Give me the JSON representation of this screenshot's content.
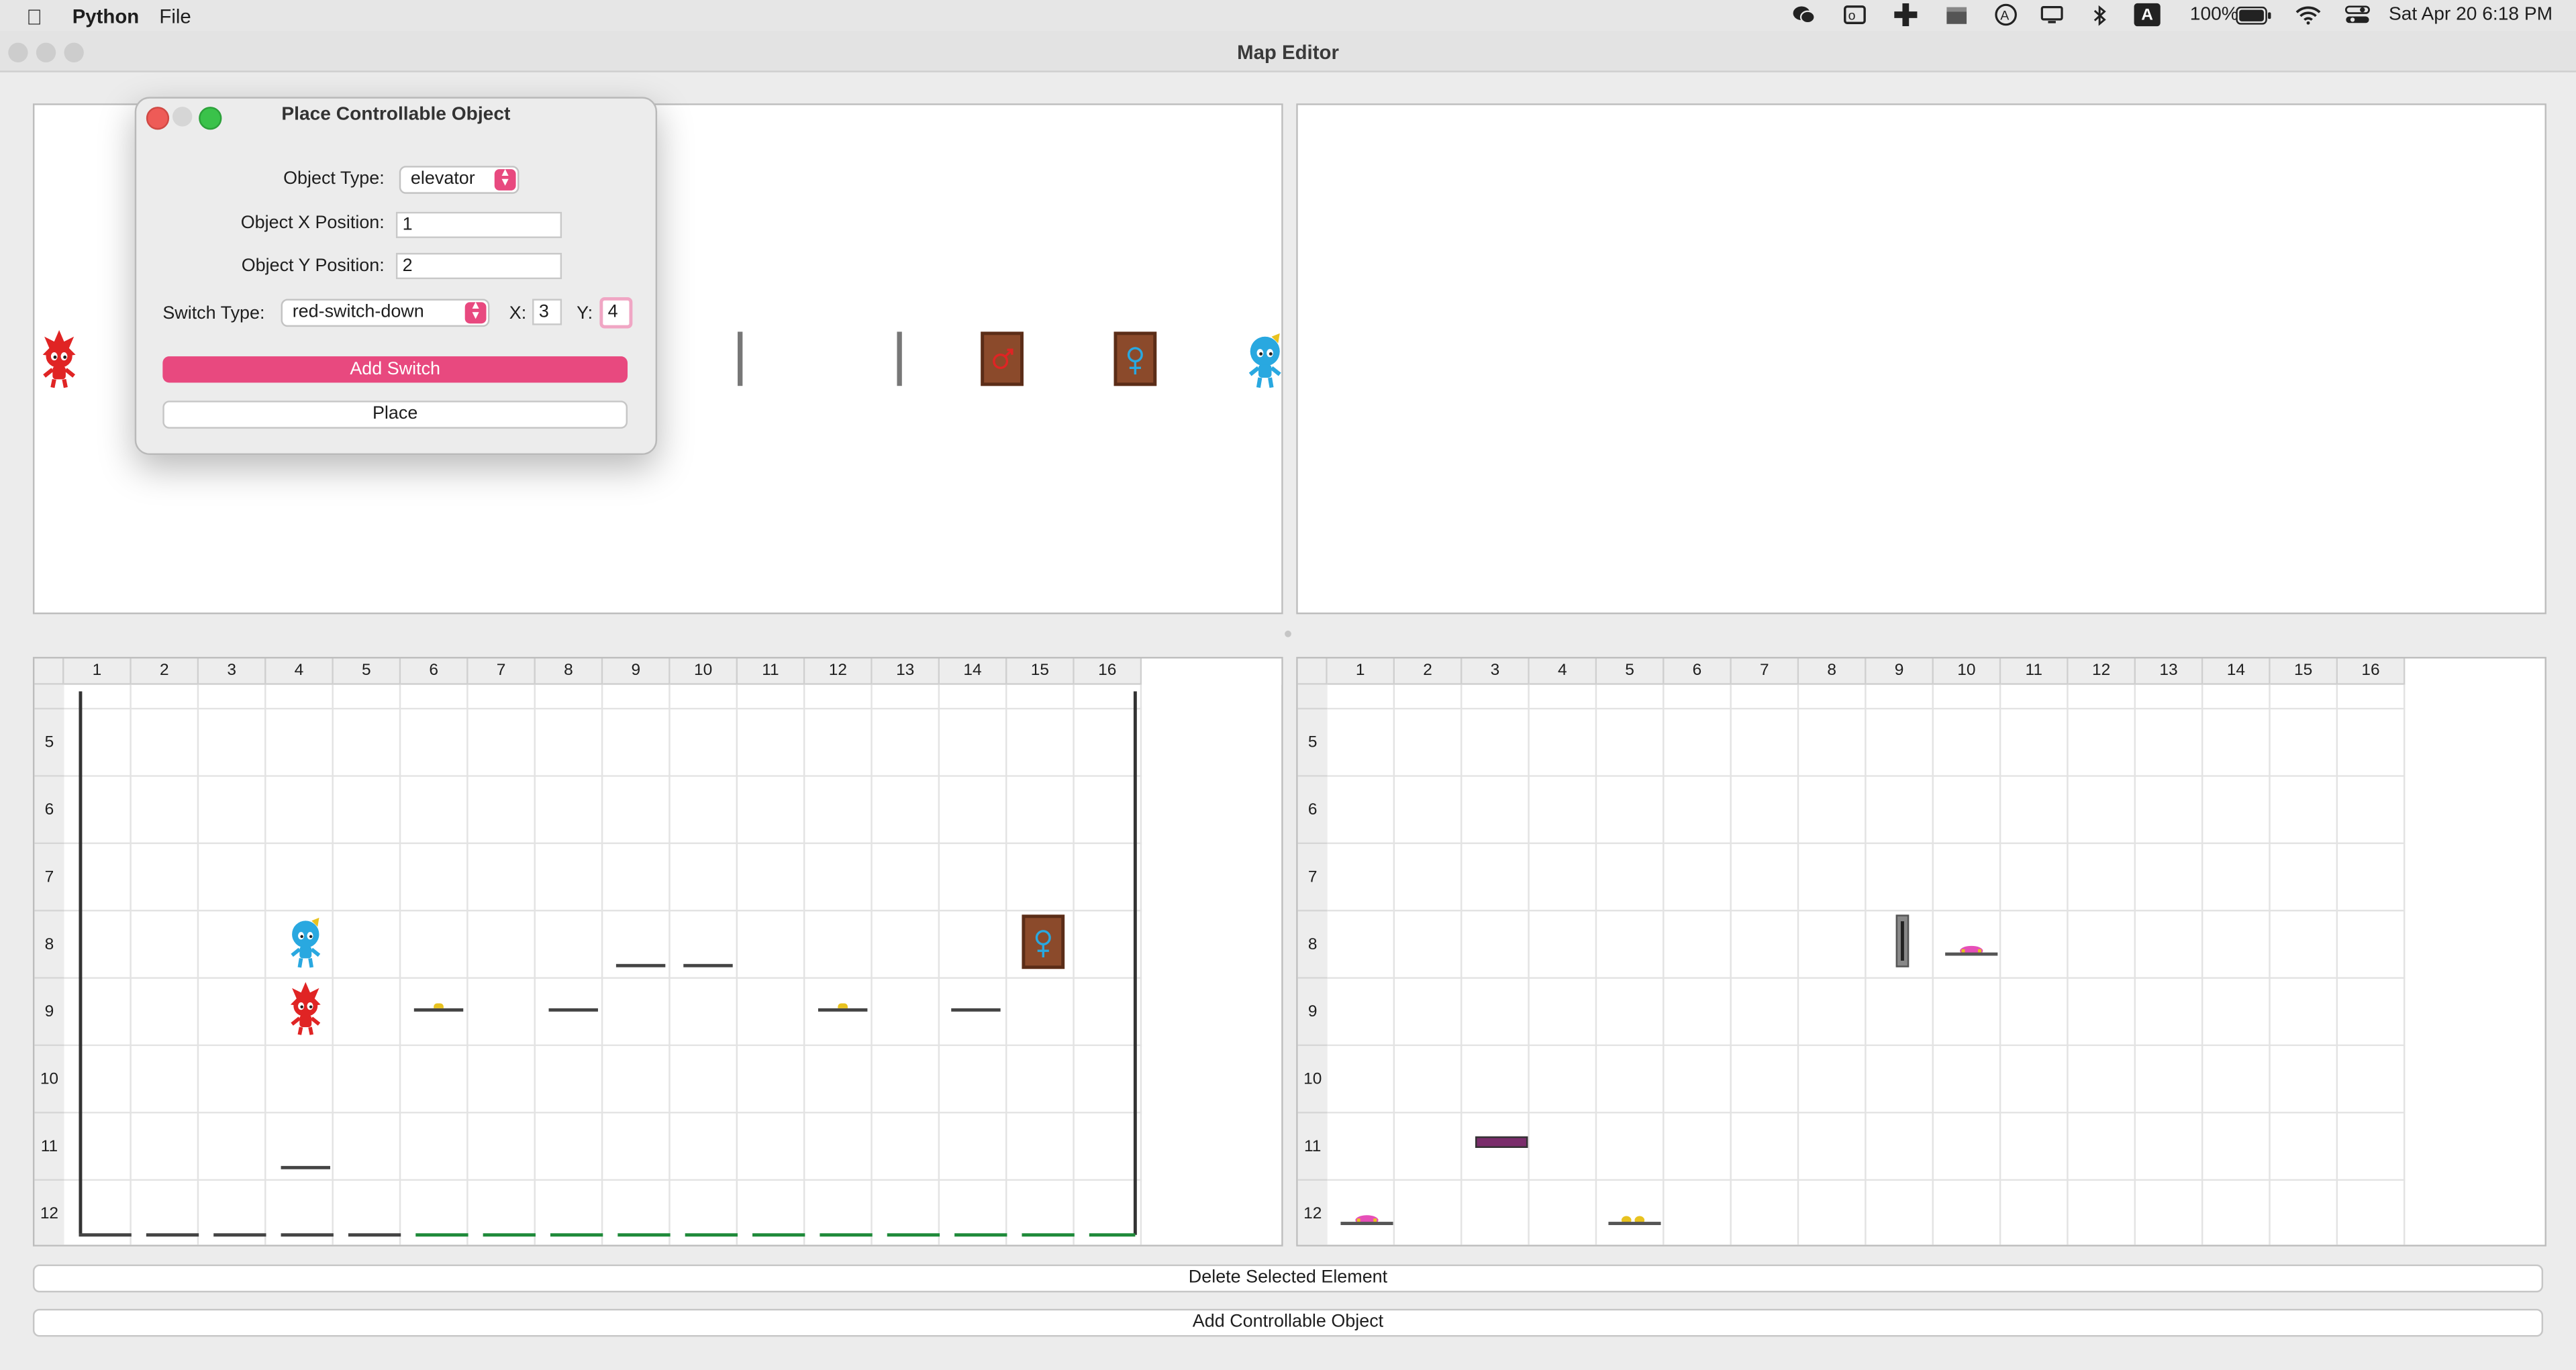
{
  "menubar": {
    "app": "Python",
    "file": "File",
    "battery": "100%",
    "datetime": "Sat Apr 20  6:18 PM",
    "status_icons": [
      "wechat-icon",
      "outlook-icon",
      "plus-icon",
      "clapper-icon",
      "circle-a-icon",
      "display-icon",
      "bluetooth-icon",
      "input-a-icon",
      "battery-icon",
      "wifi-icon",
      "control-center-icon"
    ],
    "input_letter": "A"
  },
  "window": {
    "title": "Map Editor"
  },
  "dialog": {
    "title": "Place Controllable Object",
    "object_type_label": "Object Type:",
    "object_type_value": "elevator",
    "x_label": "Object X Position:",
    "x_value": "1",
    "y_label": "Object Y Position:",
    "y_value": "2",
    "switch_type_label": "Switch Type:",
    "switch_type_value": "red-switch-down",
    "switch_x_label": "X:",
    "switch_x_value": "3",
    "switch_y_label": "Y:",
    "switch_y_value": "4",
    "add_switch": "Add Switch",
    "place": "Place"
  },
  "left_grid": {
    "columns": [
      "1",
      "2",
      "3",
      "4",
      "5",
      "6",
      "7",
      "8",
      "9",
      "10",
      "11",
      "12",
      "13",
      "14",
      "15",
      "16"
    ],
    "rows": [
      "5",
      "6",
      "7",
      "8",
      "9",
      "10",
      "11",
      "12"
    ]
  },
  "right_grid": {
    "columns": [
      "1",
      "2",
      "3",
      "4",
      "5",
      "6",
      "7",
      "8",
      "9",
      "10",
      "11",
      "12",
      "13",
      "14",
      "15",
      "16"
    ],
    "rows": [
      "5",
      "6",
      "7",
      "8",
      "9",
      "10",
      "11",
      "12"
    ]
  },
  "buttons": {
    "delete": "Delete Selected Element",
    "add_controllable": "Add Controllable Object"
  },
  "colors": {
    "accent": "#e8497f",
    "fire": "#e02424",
    "water": "#29a8e0",
    "door": "#8b4a2b",
    "elevator": "#7a2d6b"
  }
}
